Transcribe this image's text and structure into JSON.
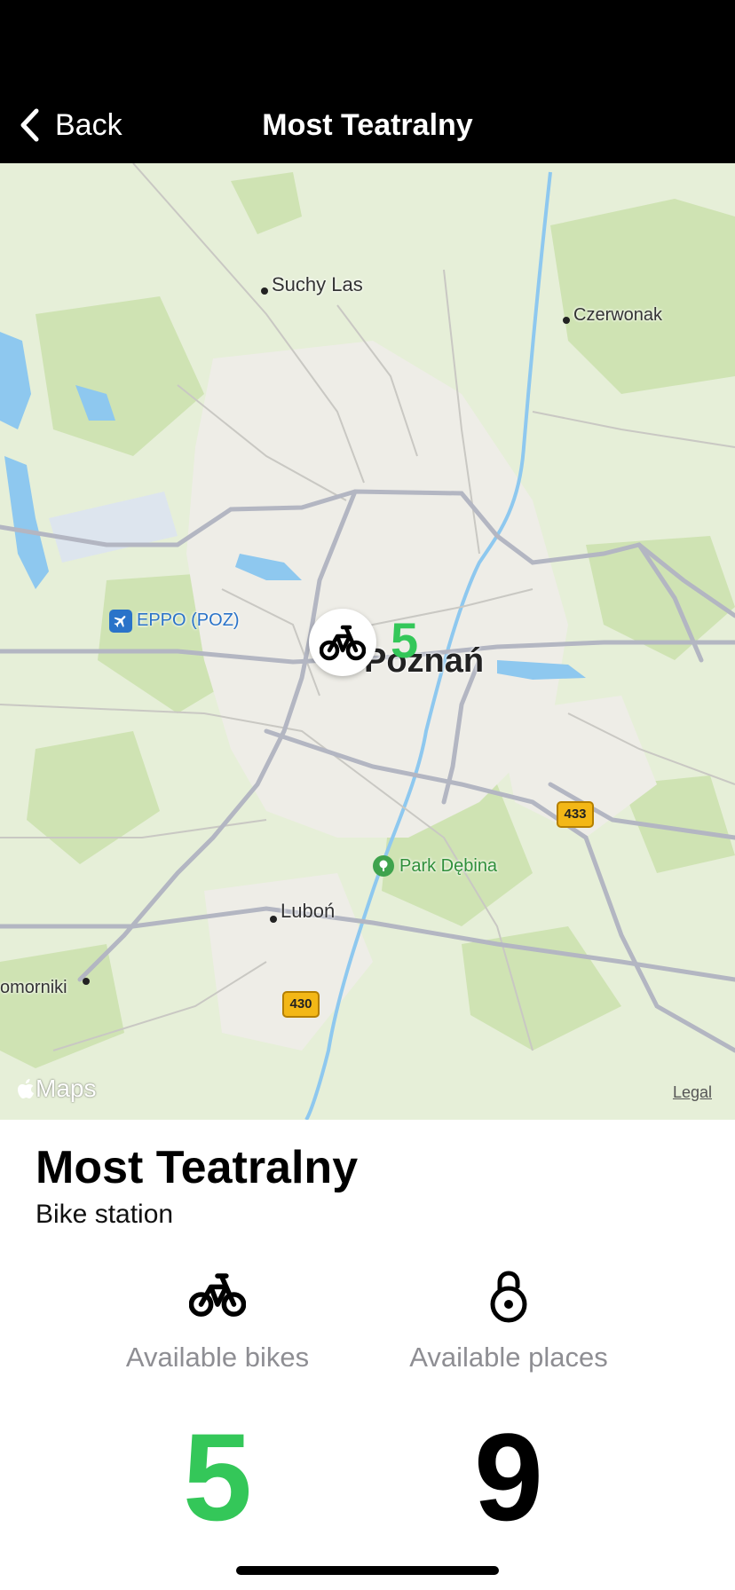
{
  "navbar": {
    "back_label": "Back",
    "title": "Most Teatralny"
  },
  "map": {
    "places": {
      "suchy_las": "Suchy Las",
      "czerwonak": "Czerwonak",
      "eppo": "EPPO (POZ)",
      "poznan": "Poznań",
      "park_debina": "Park Dębina",
      "lubon": "Luboń",
      "komorniki": "omorniki"
    },
    "road_433": "433",
    "road_430": "430",
    "pin_count": "5",
    "attribution": "Maps",
    "legal": "Legal"
  },
  "station": {
    "title": "Most Teatralny",
    "subtitle": "Bike station"
  },
  "stats": {
    "bikes_label": "Available bikes",
    "bikes_value": "5",
    "places_label": "Available places",
    "places_value": "9"
  },
  "colors": {
    "accent_green": "#34c759",
    "navbar_bg": "#000000",
    "secondary_text": "#8e8e93"
  },
  "icons": {
    "back": "chevron-left-icon",
    "bike": "bicycle-icon",
    "lock": "lock-open-icon",
    "airport": "airplane-icon",
    "park": "tree-icon",
    "apple": "apple-logo-icon"
  }
}
